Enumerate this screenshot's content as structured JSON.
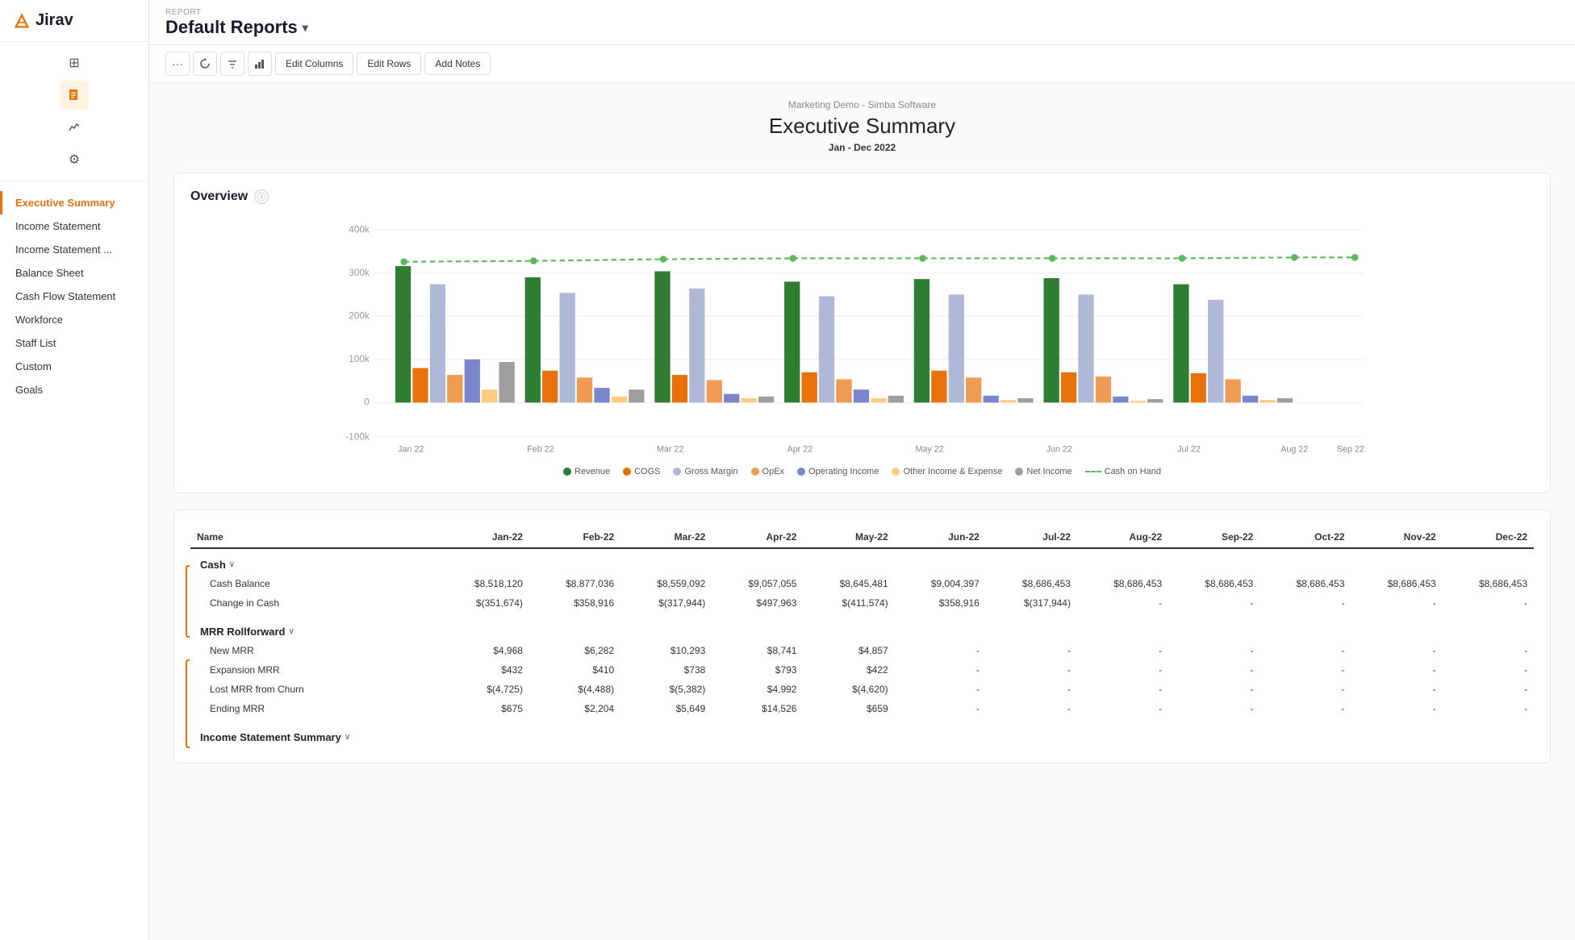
{
  "app": {
    "name": "Jirav",
    "logo_char": "J"
  },
  "sidebar": {
    "report_label": "REPORT",
    "title": "Default Reports",
    "nav_items": [
      {
        "label": "Executive Summary",
        "active": true
      },
      {
        "label": "Income Statement",
        "active": false
      },
      {
        "label": "Income Statement ...",
        "active": false
      },
      {
        "label": "Balance Sheet",
        "active": false
      },
      {
        "label": "Cash Flow Statement",
        "active": false
      },
      {
        "label": "Workforce",
        "active": false
      },
      {
        "label": "Staff List",
        "active": false
      },
      {
        "label": "Custom",
        "active": false
      },
      {
        "label": "Goals",
        "active": false
      }
    ],
    "icons": [
      {
        "name": "grid-icon",
        "char": "⊞",
        "active": false
      },
      {
        "name": "document-icon",
        "char": "📄",
        "active": true
      },
      {
        "name": "chart-icon",
        "char": "📈",
        "active": false
      },
      {
        "name": "gear-icon",
        "char": "⚙",
        "active": false
      }
    ]
  },
  "toolbar": {
    "buttons": [
      {
        "label": "...",
        "name": "more-button"
      },
      {
        "label": "↻",
        "name": "refresh-button"
      },
      {
        "label": "↕",
        "name": "sort-button"
      },
      {
        "label": "▦",
        "name": "chart-toggle-button"
      },
      {
        "label": "Edit Columns",
        "name": "edit-columns-button"
      },
      {
        "label": "Edit Rows",
        "name": "edit-rows-button"
      },
      {
        "label": "Add Notes",
        "name": "add-notes-button"
      }
    ]
  },
  "report": {
    "subtitle": "Marketing Demo - Simba Software",
    "title": "Executive Summary",
    "date_range": "Jan - Dec 2022"
  },
  "overview": {
    "title": "Overview",
    "chart": {
      "y_labels": [
        "400k",
        "300k",
        "200k",
        "100k",
        "0",
        "-100k"
      ],
      "x_labels": [
        "Jan 22",
        "Feb 22",
        "Mar 22",
        "Apr 22",
        "May 22",
        "Jun 22",
        "Jul 22",
        "Aug 22",
        "Sep 22"
      ],
      "legend": [
        {
          "label": "Revenue",
          "color": "#2e7d32",
          "type": "bar"
        },
        {
          "label": "COGS",
          "color": "#e8710a",
          "type": "bar"
        },
        {
          "label": "Gross Margin",
          "color": "#b0b8d8",
          "type": "bar"
        },
        {
          "label": "OpEx",
          "color": "#e8710a",
          "type": "bar"
        },
        {
          "label": "Operating Income",
          "color": "#7986cb",
          "type": "bar"
        },
        {
          "label": "Other Income & Expense",
          "color": "#ffcc80",
          "type": "bar"
        },
        {
          "label": "Net Income",
          "color": "#9e9e9e",
          "type": "bar"
        },
        {
          "label": "Cash on Hand",
          "color": "#5cb85c",
          "type": "dashed"
        }
      ]
    }
  },
  "table": {
    "columns": [
      "Name",
      "Jan-22",
      "Feb-22",
      "Mar-22",
      "Apr-22",
      "May-22",
      "Jun-22",
      "Jul-22",
      "Aug-22",
      "Sep-22",
      "Oct-22",
      "Nov-22",
      "Dec-22"
    ],
    "sections": [
      {
        "name": "Cash",
        "collapsible": true,
        "rows": [
          {
            "name": "Cash Balance",
            "values": [
              "$8,518,120",
              "$8,877,036",
              "$8,559,092",
              "$9,057,055",
              "$8,645,481",
              "$9,004,397",
              "$8,686,453",
              "$8,686,453",
              "$8,686,453",
              "$8,686,453",
              "$8,686,453",
              "$8,686,453"
            ]
          },
          {
            "name": "Change in Cash",
            "values": [
              "$(351,674)",
              "$358,916",
              "$(317,944)",
              "$497,963",
              "$(411,574)",
              "$358,916",
              "$(317,944)",
              "-",
              "-",
              "-",
              "-",
              "-"
            ]
          }
        ]
      },
      {
        "name": "MRR Rollforward",
        "collapsible": true,
        "rows": [
          {
            "name": "New MRR",
            "values": [
              "$4,968",
              "$6,282",
              "$10,293",
              "$8,741",
              "$4,857",
              "-",
              "-",
              "-",
              "-",
              "-",
              "-",
              "-"
            ]
          },
          {
            "name": "Expansion MRR",
            "values": [
              "$432",
              "$410",
              "$738",
              "$793",
              "$422",
              "-",
              "-",
              "-",
              "-",
              "-",
              "-",
              "-"
            ]
          },
          {
            "name": "Lost MRR from Churn",
            "values": [
              "$(4,725)",
              "$(4,488)",
              "$(5,382)",
              "$4,992",
              "$(4,620)",
              "-",
              "-",
              "-",
              "-",
              "-",
              "-",
              "-"
            ]
          },
          {
            "name": "Ending MRR",
            "values": [
              "$675",
              "$2,204",
              "$5,649",
              "$14,526",
              "$659",
              "-",
              "-",
              "-",
              "-",
              "-",
              "-",
              "-"
            ]
          }
        ]
      },
      {
        "name": "Income Statement Summary",
        "collapsible": true,
        "rows": []
      }
    ]
  },
  "colors": {
    "accent": "#e8710a",
    "nav_active": "#e8710a",
    "revenue": "#2e7d32",
    "cogs": "#e8710a",
    "gross_margin": "#b0b8d8",
    "opex": "#e8710a",
    "operating_income": "#7986cb",
    "other": "#ffcc80",
    "net_income": "#9e9e9e",
    "cash_on_hand": "#5cb85c"
  }
}
